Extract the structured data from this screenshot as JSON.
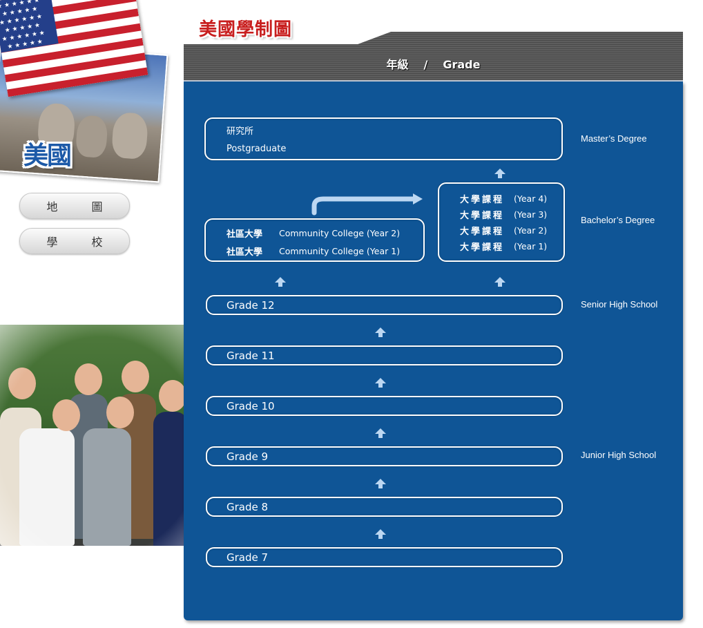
{
  "page_title": "美國學制圖",
  "country_label": "美國",
  "sidebar": {
    "buttons": [
      {
        "label": "地 圖"
      },
      {
        "label": "學 校"
      }
    ]
  },
  "header": {
    "zh": "年級",
    "separator": "/",
    "en": "Grade"
  },
  "postgraduate": {
    "zh": "研究所",
    "en": "Postgraduate"
  },
  "community_college": [
    {
      "zh": "社區大學",
      "en": "Community College (Year 2)"
    },
    {
      "zh": "社區大學",
      "en": "Community College (Year 1)"
    }
  ],
  "university": [
    {
      "zh": "大學課程",
      "en": "(Year 4)"
    },
    {
      "zh": "大學課程",
      "en": "(Year 3)"
    },
    {
      "zh": "大學課程",
      "en": "(Year 2)"
    },
    {
      "zh": "大學課程",
      "en": "(Year 1)"
    }
  ],
  "grades": [
    "Grade 12",
    "Grade 11",
    "Grade 10",
    "Grade 9",
    "Grade 8",
    "Grade 7"
  ],
  "stage_labels": {
    "masters": "Master’s Degree",
    "bachelors": "Bachelor’s Degree",
    "senior_high": "Senior High School",
    "junior_high": "Junior High School"
  },
  "colors": {
    "panel_blue": "#0f5596",
    "arrow_light_blue": "#bcd7f2",
    "title_red": "#c81e1e",
    "country_blue": "#1d5aa8"
  },
  "icons": [
    "us-flag-icon",
    "up-arrow-icon",
    "curved-right-arrow-icon"
  ]
}
